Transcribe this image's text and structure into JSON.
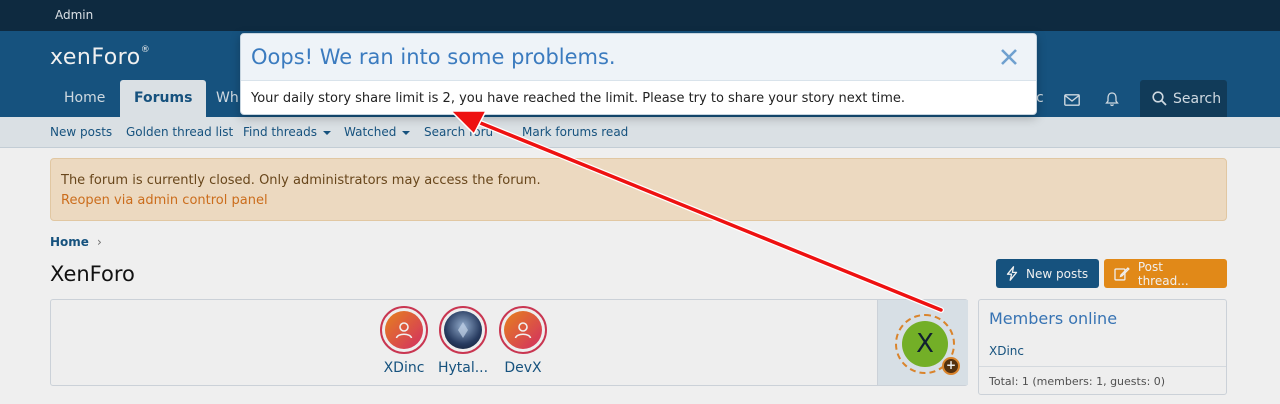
{
  "admin_bar": {
    "label": "Admin"
  },
  "header": {
    "logo": "xenForo",
    "logo_mark": "®",
    "nav_tabs": [
      {
        "label": "Home"
      },
      {
        "label": "Forums"
      },
      {
        "label": "Wh"
      }
    ],
    "search_label": "Search",
    "partial_text": "c"
  },
  "subnav": {
    "items": [
      {
        "label": "New posts"
      },
      {
        "label": "Golden thread list"
      },
      {
        "label": "Find threads"
      },
      {
        "label": "Watched"
      },
      {
        "label": "Search foru"
      },
      {
        "label": "Mark forums read"
      }
    ]
  },
  "notice": {
    "text": "The forum is currently closed. Only administrators may access the forum.",
    "link": "Reopen via admin control panel"
  },
  "breadcrumb": {
    "home": "Home",
    "chevron": "›"
  },
  "page_title": "XenForo",
  "buttons": {
    "new_posts": "New posts",
    "post_thread": "Post thread..."
  },
  "stories": {
    "items": [
      {
        "name": "XDinc"
      },
      {
        "name": "Hytal..."
      },
      {
        "name": "DevX"
      }
    ],
    "my_story": {
      "initial": "X",
      "plus": "+"
    }
  },
  "members_online": {
    "title": "Members online",
    "member": "XDinc",
    "total": "Total: 1 (members: 1, guests: 0)"
  },
  "modal": {
    "title": "Oops! We ran into some problems.",
    "message": "Your daily story share limit is 2, you have reached the limit. Please try to share your story next time."
  },
  "colors": {
    "header_bg": "#185886",
    "admin_bg": "#0f2d45",
    "accent_orange": "#f0921a",
    "arrow_red": "#ee1111"
  }
}
